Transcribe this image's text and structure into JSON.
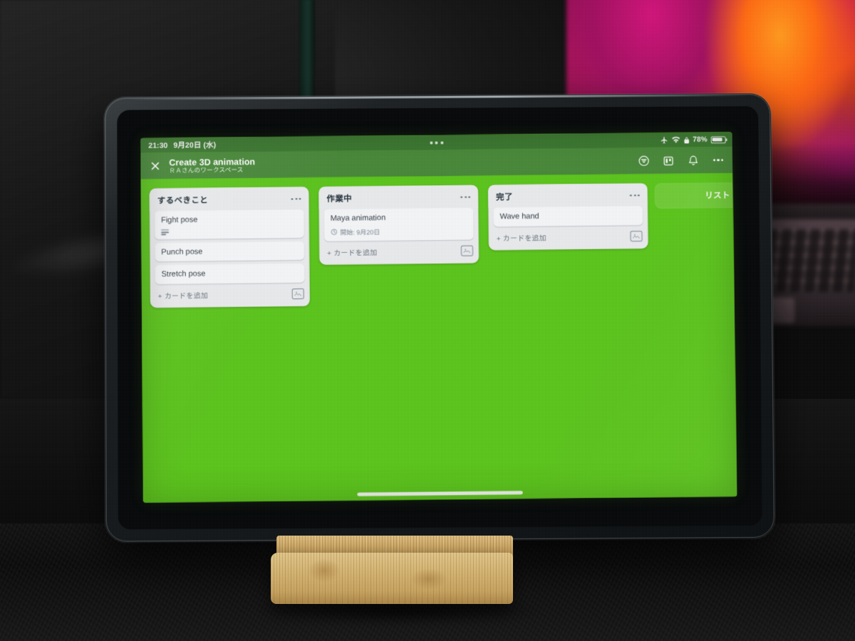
{
  "status_bar": {
    "time": "21:30",
    "date": "9月20日 (水)",
    "airplane_icon": "airplane-icon",
    "wifi_icon": "wifi-icon",
    "lock_icon": "orientation-lock-icon",
    "battery_percent": "78%",
    "battery_icon": "battery-icon",
    "multitask_dots": "multitasking-dots-icon"
  },
  "board_header": {
    "close_icon": "close-icon",
    "title": "Create 3D animation",
    "workspace": "ＲＡさんのワークスペース",
    "actions": [
      {
        "name": "filter-icon",
        "label": "フィルター"
      },
      {
        "name": "board-view-icon",
        "label": "ボード"
      },
      {
        "name": "bell-icon",
        "label": "通知"
      },
      {
        "name": "more-icon",
        "label": "その他"
      }
    ]
  },
  "board": {
    "background_color": "#5cc41c",
    "header_color": "#4b8c3c",
    "add_list_label": "リスト",
    "lists": [
      {
        "title": "するべきこと",
        "menu_icon": "list-menu-icon",
        "cards": [
          {
            "title": "Fight pose",
            "has_description": true,
            "description_icon": "description-icon"
          },
          {
            "title": "Punch pose",
            "has_description": false
          },
          {
            "title": "Stretch pose",
            "has_description": false
          }
        ],
        "add_card_label": "+ カードを追加",
        "template_icon": "card-template-icon"
      },
      {
        "title": "作業中",
        "menu_icon": "list-menu-icon",
        "cards": [
          {
            "title": "Maya animation",
            "has_description": false,
            "date_icon": "clock-icon",
            "date_label": "開始: 9月20日"
          }
        ],
        "add_card_label": "+ カードを追加",
        "template_icon": "card-template-icon"
      },
      {
        "title": "完了",
        "menu_icon": "list-menu-icon",
        "cards": [
          {
            "title": "Wave hand",
            "has_description": false
          }
        ],
        "add_card_label": "+ カードを追加",
        "template_icon": "card-template-icon"
      }
    ]
  },
  "home_indicator": "home-indicator"
}
